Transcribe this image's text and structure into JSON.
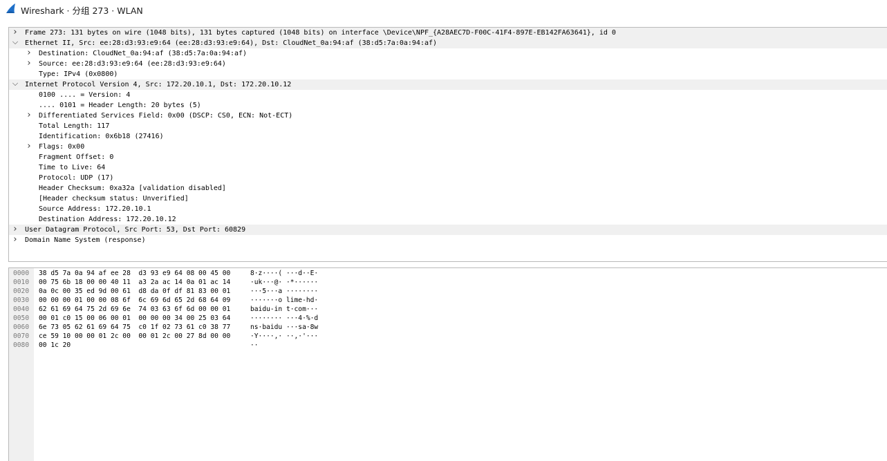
{
  "window": {
    "title": "Wireshark · 分组 273 · WLAN",
    "icon": "wireshark-fin-icon"
  },
  "colors": {
    "shaded_row": "#f0f0f0",
    "border": "#b9b9b9",
    "logo_blue": "#1e6fc8"
  },
  "tree": [
    {
      "depth": 0,
      "expander": "collapsed",
      "shaded": true,
      "text": "Frame 273: 131 bytes on wire (1048 bits), 131 bytes captured (1048 bits) on interface \\Device\\NPF_{A28AEC7D-F00C-41F4-897E-EB142FA63641}, id 0"
    },
    {
      "depth": 0,
      "expander": "expanded",
      "shaded": true,
      "text": "Ethernet II, Src: ee:28:d3:93:e9:64 (ee:28:d3:93:e9:64), Dst: CloudNet_0a:94:af (38:d5:7a:0a:94:af)"
    },
    {
      "depth": 1,
      "expander": "collapsed",
      "shaded": false,
      "text": "Destination: CloudNet_0a:94:af (38:d5:7a:0a:94:af)"
    },
    {
      "depth": 1,
      "expander": "collapsed",
      "shaded": false,
      "text": "Source: ee:28:d3:93:e9:64 (ee:28:d3:93:e9:64)"
    },
    {
      "depth": 1,
      "expander": "none",
      "shaded": false,
      "text": "Type: IPv4 (0x0800)"
    },
    {
      "depth": 0,
      "expander": "expanded",
      "shaded": true,
      "text": "Internet Protocol Version 4, Src: 172.20.10.1, Dst: 172.20.10.12"
    },
    {
      "depth": 1,
      "expander": "none",
      "shaded": false,
      "text": "0100 .... = Version: 4"
    },
    {
      "depth": 1,
      "expander": "none",
      "shaded": false,
      "text": ".... 0101 = Header Length: 20 bytes (5)"
    },
    {
      "depth": 1,
      "expander": "collapsed",
      "shaded": false,
      "text": "Differentiated Services Field: 0x00 (DSCP: CS0, ECN: Not-ECT)"
    },
    {
      "depth": 1,
      "expander": "none",
      "shaded": false,
      "text": "Total Length: 117"
    },
    {
      "depth": 1,
      "expander": "none",
      "shaded": false,
      "text": "Identification: 0x6b18 (27416)"
    },
    {
      "depth": 1,
      "expander": "collapsed",
      "shaded": false,
      "text": "Flags: 0x00"
    },
    {
      "depth": 1,
      "expander": "none",
      "shaded": false,
      "text": "Fragment Offset: 0"
    },
    {
      "depth": 1,
      "expander": "none",
      "shaded": false,
      "text": "Time to Live: 64"
    },
    {
      "depth": 1,
      "expander": "none",
      "shaded": false,
      "text": "Protocol: UDP (17)"
    },
    {
      "depth": 1,
      "expander": "none",
      "shaded": false,
      "text": "Header Checksum: 0xa32a [validation disabled]"
    },
    {
      "depth": 1,
      "expander": "none",
      "shaded": false,
      "text": "[Header checksum status: Unverified]"
    },
    {
      "depth": 1,
      "expander": "none",
      "shaded": false,
      "text": "Source Address: 172.20.10.1"
    },
    {
      "depth": 1,
      "expander": "none",
      "shaded": false,
      "text": "Destination Address: 172.20.10.12"
    },
    {
      "depth": 0,
      "expander": "collapsed",
      "shaded": true,
      "text": "User Datagram Protocol, Src Port: 53, Dst Port: 60829"
    },
    {
      "depth": 0,
      "expander": "collapsed",
      "shaded": false,
      "text": "Domain Name System (response)"
    }
  ],
  "bytes": [
    {
      "offset": "0000",
      "hex": "38 d5 7a 0a 94 af ee 28  d3 93 e9 64 08 00 45 00",
      "ascii": "8·z····( ···d··E·"
    },
    {
      "offset": "0010",
      "hex": "00 75 6b 18 00 00 40 11  a3 2a ac 14 0a 01 ac 14",
      "ascii": "·uk···@· ·*······"
    },
    {
      "offset": "0020",
      "hex": "0a 0c 00 35 ed 9d 00 61  d8 da 0f df 81 83 00 01",
      "ascii": "···5···a ········"
    },
    {
      "offset": "0030",
      "hex": "00 00 00 01 00 00 08 6f  6c 69 6d 65 2d 68 64 09",
      "ascii": "·······o lime-hd·"
    },
    {
      "offset": "0040",
      "hex": "62 61 69 64 75 2d 69 6e  74 03 63 6f 6d 00 00 01",
      "ascii": "baidu-in t·com···"
    },
    {
      "offset": "0050",
      "hex": "00 01 c0 15 00 06 00 01  00 00 00 34 00 25 03 64",
      "ascii": "········ ···4·%·d"
    },
    {
      "offset": "0060",
      "hex": "6e 73 05 62 61 69 64 75  c0 1f 02 73 61 c0 38 77",
      "ascii": "ns·baidu ···sa·8w"
    },
    {
      "offset": "0070",
      "hex": "ce 59 10 00 00 01 2c 00  00 01 2c 00 27 8d 00 00",
      "ascii": "·Y····,· ··,·'···"
    },
    {
      "offset": "0080",
      "hex": "00 1c 20",
      "ascii": "··"
    }
  ]
}
